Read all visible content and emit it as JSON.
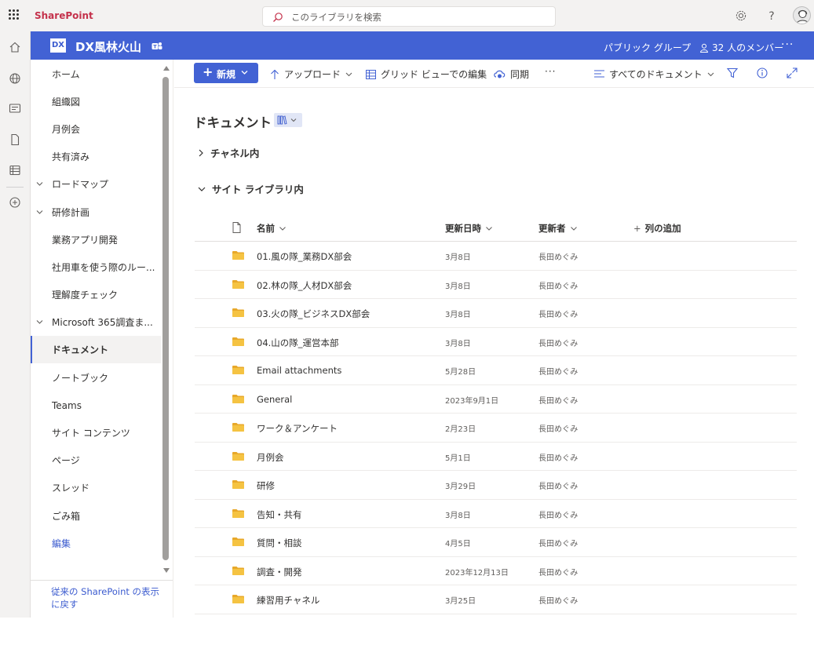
{
  "suite": {
    "brand": "SharePoint",
    "search_placeholder": "このライブラリを検索"
  },
  "site": {
    "logo_text": "DX",
    "title": "DX風林火山",
    "group_type": "パブリック グループ",
    "members": "32 人のメンバー",
    "more": "···"
  },
  "nav": {
    "items": [
      {
        "label": "ホーム",
        "expandable": false
      },
      {
        "label": "組織図",
        "expandable": false
      },
      {
        "label": "月例会",
        "expandable": false
      },
      {
        "label": "共有済み",
        "expandable": false
      },
      {
        "label": "ロードマップ",
        "expandable": true
      },
      {
        "label": "研修計画",
        "expandable": true
      },
      {
        "label": "業務アプリ開発",
        "expandable": false
      },
      {
        "label": "社用車を使う際のルー...",
        "expandable": false
      },
      {
        "label": "理解度チェック",
        "expandable": false
      },
      {
        "label": "Microsoft 365調査ま...",
        "expandable": true
      },
      {
        "label": "ドキュメント",
        "expandable": false,
        "selected": true
      },
      {
        "label": "ノートブック",
        "expandable": false
      },
      {
        "label": "Teams",
        "expandable": false
      },
      {
        "label": "サイト コンテンツ",
        "expandable": false
      },
      {
        "label": "ページ",
        "expandable": false
      },
      {
        "label": "スレッド",
        "expandable": false
      },
      {
        "label": "ごみ箱",
        "expandable": false
      },
      {
        "label": "編集",
        "expandable": false,
        "edit": true
      }
    ],
    "classic_link": "従来の SharePoint の表示に戻す"
  },
  "toolbar": {
    "new_label": "新規",
    "upload_label": "アップロード",
    "grid_edit_label": "グリッド ビューでの編集",
    "sync_label": "同期",
    "overflow_label": "···",
    "view_label": "すべてのドキュメント"
  },
  "main": {
    "title": "ドキュメント",
    "section_channel": "チャネル内",
    "section_site": "サイト ライブラリ内",
    "columns": {
      "name": "名前",
      "modified": "更新日時",
      "modified_by": "更新者",
      "add_column": "列の追加"
    },
    "rows": [
      {
        "name": "01.風の隊_業務DX部会",
        "modified": "3月8日",
        "by": "長田めぐみ"
      },
      {
        "name": "02.林の隊_人材DX部会",
        "modified": "3月8日",
        "by": "長田めぐみ"
      },
      {
        "name": "03.火の隊_ビジネスDX部会",
        "modified": "3月8日",
        "by": "長田めぐみ"
      },
      {
        "name": "04.山の隊_運営本部",
        "modified": "3月8日",
        "by": "長田めぐみ"
      },
      {
        "name": "Email attachments",
        "modified": "5月28日",
        "by": "長田めぐみ"
      },
      {
        "name": "General",
        "modified": "2023年9月1日",
        "by": "長田めぐみ"
      },
      {
        "name": "ワーク＆アンケート",
        "modified": "2月23日",
        "by": "長田めぐみ"
      },
      {
        "name": "月例会",
        "modified": "5月1日",
        "by": "長田めぐみ"
      },
      {
        "name": "研修",
        "modified": "3月29日",
        "by": "長田めぐみ"
      },
      {
        "name": "告知・共有",
        "modified": "3月8日",
        "by": "長田めぐみ"
      },
      {
        "name": "質問・相談",
        "modified": "4月5日",
        "by": "長田めぐみ"
      },
      {
        "name": "調査・開発",
        "modified": "2023年12月13日",
        "by": "長田めぐみ"
      },
      {
        "name": "練習用チャネル",
        "modified": "3月25日",
        "by": "長田めぐみ"
      }
    ]
  },
  "colors": {
    "site_header": "#4262d4",
    "brand_red": "#c4314b",
    "folder_yellow": "#f5c342",
    "link_blue": "#3b5bcf"
  }
}
